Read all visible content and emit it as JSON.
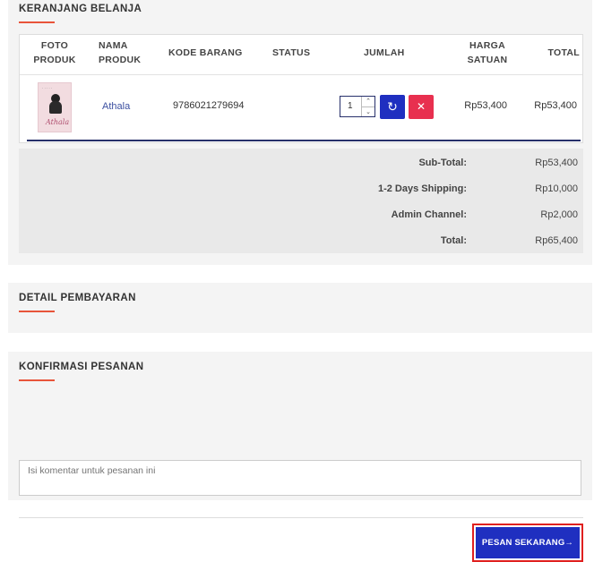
{
  "cart": {
    "title": "KERANJANG BELANJA",
    "columns": {
      "photo": [
        "FOTO",
        "PRODUK"
      ],
      "name": [
        "NAMA",
        "PRODUK"
      ],
      "code": "KODE BARANG",
      "status": "STATUS",
      "qty": "JUMLAH",
      "unit_price": [
        "HARGA",
        "SATUAN"
      ],
      "total": "TOTAL"
    },
    "items": [
      {
        "cover_script": "Athala",
        "name": "Athala",
        "code": "9786021279694",
        "status": "",
        "quantity": "1",
        "unit_price": "Rp53,400",
        "total": "Rp53,400"
      }
    ],
    "summary": [
      {
        "label": "Sub-Total:",
        "value": "Rp53,400"
      },
      {
        "label": "1-2 Days Shipping:",
        "value": "Rp10,000"
      },
      {
        "label": "Admin Channel:",
        "value": "Rp2,000"
      },
      {
        "label": "Total:",
        "value": "Rp65,400"
      }
    ]
  },
  "payment": {
    "title": "DETAIL PEMBAYARAN"
  },
  "confirmation": {
    "title": "KONFIRMASI PESANAN",
    "comment_placeholder": "Isi komentar untuk pesanan ini",
    "order_button": "PESAN SEKARANG",
    "order_button_icon": "→"
  },
  "icons": {
    "refresh": "↻",
    "remove": "✕",
    "spin_up": "⌃",
    "spin_down": "⌄"
  },
  "colors": {
    "accent": "#e8543a",
    "primary": "#1f2fc0",
    "danger": "#e8304f",
    "highlight": "#e0201f"
  }
}
